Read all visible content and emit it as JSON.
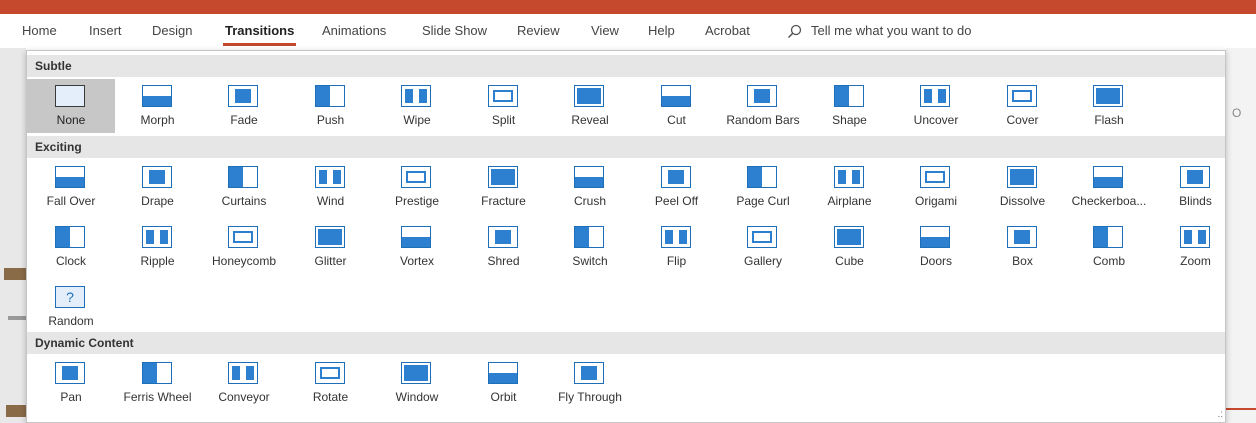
{
  "ribbon": {
    "tabs": [
      "Home",
      "Insert",
      "Design",
      "Transitions",
      "Animations",
      "Slide Show",
      "Review",
      "View",
      "Help",
      "Acrobat"
    ],
    "active_tab": "Transitions",
    "tell_me": "Tell me what you want to do"
  },
  "background": {
    "partial_letter": "O"
  },
  "gallery": {
    "sections": [
      {
        "title": "Subtle",
        "items": [
          "None",
          "Morph",
          "Fade",
          "Push",
          "Wipe",
          "Split",
          "Reveal",
          "Cut",
          "Random Bars",
          "Shape",
          "Uncover",
          "Cover",
          "Flash"
        ]
      },
      {
        "title": "Exciting",
        "items": [
          "Fall Over",
          "Drape",
          "Curtains",
          "Wind",
          "Prestige",
          "Fracture",
          "Crush",
          "Peel Off",
          "Page Curl",
          "Airplane",
          "Origami",
          "Dissolve",
          "Checkerboa...",
          "Blinds",
          "Clock",
          "Ripple",
          "Honeycomb",
          "Glitter",
          "Vortex",
          "Shred",
          "Switch",
          "Flip",
          "Gallery",
          "Cube",
          "Doors",
          "Box",
          "Comb",
          "Zoom",
          "Random"
        ]
      },
      {
        "title": "Dynamic Content",
        "items": [
          "Pan",
          "Ferris Wheel",
          "Conveyor",
          "Rotate",
          "Window",
          "Orbit",
          "Fly Through"
        ]
      }
    ],
    "selected": "None",
    "random_glyph": "?",
    "resize_grip": ".:"
  },
  "colors": {
    "accent": "#c54a2d",
    "icon_blue": "#1f6fb8"
  }
}
